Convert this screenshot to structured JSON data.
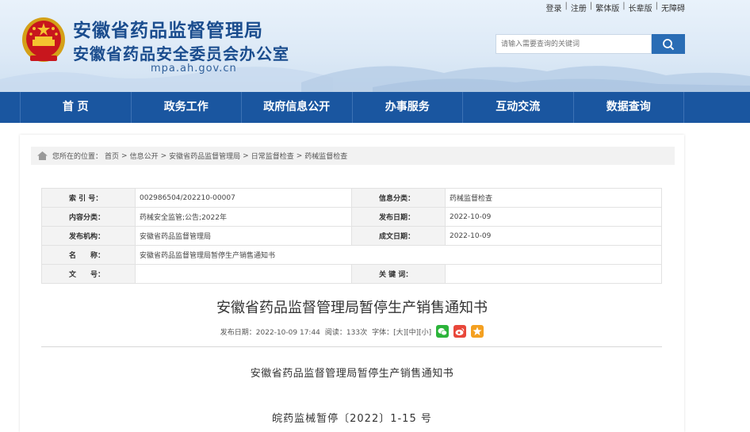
{
  "header": {
    "top_links": [
      "登录",
      "注册",
      "繁体版",
      "长辈版",
      "无障碍"
    ],
    "title_line1": "安徽省药品监督管理局",
    "title_line2": "安徽省药品安全委员会办公室",
    "domain": "mpa.ah.gov.cn",
    "search_placeholder": "请输入需要查询的关键词"
  },
  "nav": {
    "items": [
      "首 页",
      "政务工作",
      "政府信息公开",
      "办事服务",
      "互动交流",
      "数据查询"
    ]
  },
  "breadcrumb": {
    "prefix": "您所在的位置：",
    "items": [
      "首页",
      "信息公开",
      "安徽省药品监督管理局",
      "日常监督检查",
      "药械监督检查"
    ],
    "separator": ">"
  },
  "meta": {
    "index_label": "索 引 号：",
    "index_value": "002986504/202210-00007",
    "category_label": "信息分类：",
    "category_value": "药械监督检查",
    "content_label": "内容分类：",
    "content_value": "药械安全监管;公告;2022年",
    "publish_date_label": "发布日期：",
    "publish_date_value": "2022-10-09",
    "org_label": "发布机构：",
    "org_value": "安徽省药品监督管理局",
    "written_date_label": "成文日期：",
    "written_date_value": "2022-10-09",
    "name_label": "名　　称：",
    "name_value": "安徽省药品监督管理局暂停生产销售通知书",
    "doc_label": "文　　号：",
    "doc_value": "",
    "keywords_label": "关 键 词：",
    "keywords_value": ""
  },
  "article": {
    "title": "安徽省药品监督管理局暂停生产销售通知书",
    "publish_prefix": "发布日期：2022-10-09 17:44",
    "views": "阅读：133次",
    "font_label": "字体：",
    "font_large": "[大]",
    "font_medium": "[中]",
    "font_small": "[小]",
    "body_title": "安徽省药品监督管理局暂停生产销售通知书",
    "doc_number": "皖药监械暂停〔2022〕1-15 号"
  },
  "colors": {
    "nav_blue": "#1a56a0",
    "title_blue": "#1b4d8e",
    "wechat_green": "#2cb43a",
    "weibo_red": "#e8473a",
    "star_orange": "#f4a020"
  },
  "icons": {
    "search": "search-icon",
    "home": "home-icon",
    "wechat": "wechat-icon",
    "weibo": "weibo-icon",
    "favorite": "star-icon",
    "emblem": "national-emblem-icon"
  }
}
